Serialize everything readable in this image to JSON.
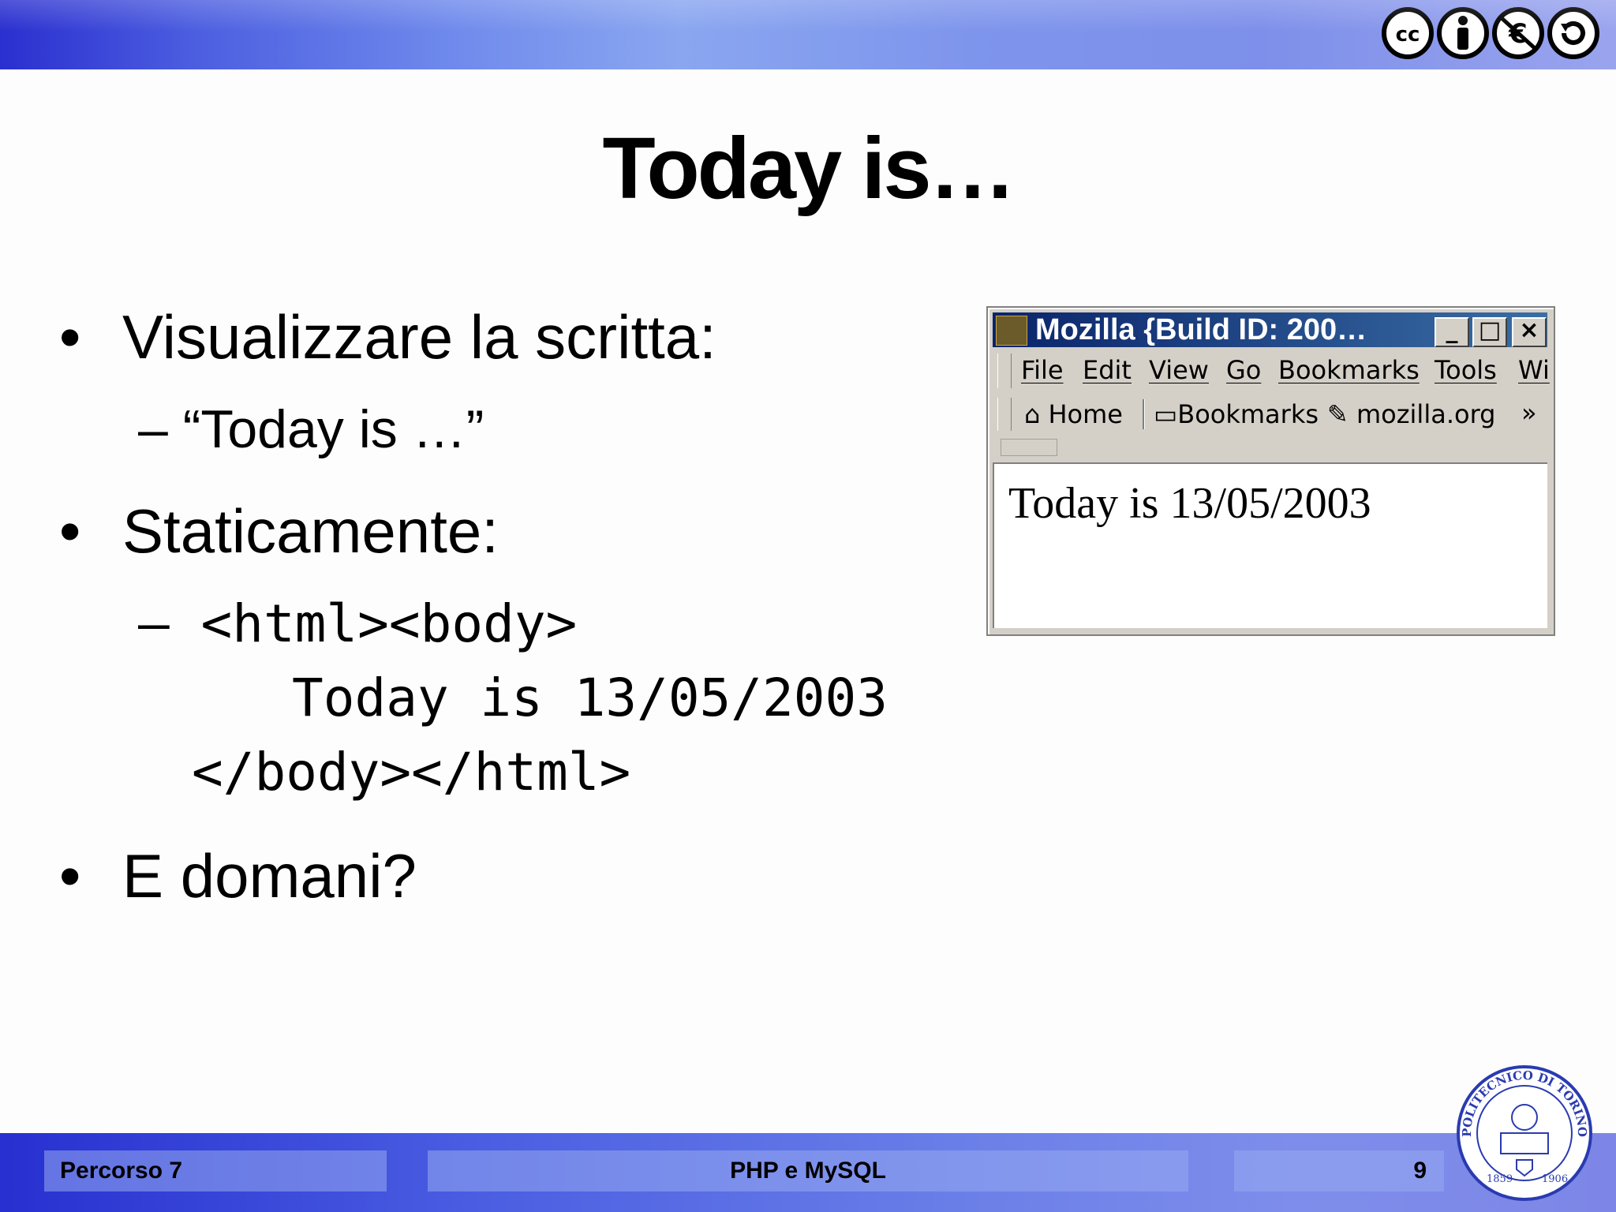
{
  "slide": {
    "title": "Today is…",
    "bullets": [
      {
        "text": "Visualizzare la scritta:",
        "sub": "– “Today is …”"
      },
      {
        "text": "Staticamente:",
        "code": [
          "– <html><body>",
          "Today is 13/05/2003",
          "</body></html>"
        ]
      },
      {
        "text": "E domani?"
      }
    ],
    "bullet_glyph": "•"
  },
  "browser": {
    "title": "Mozilla {Build ID: 200…",
    "controls": {
      "minimize": "_",
      "maximize": "□",
      "close": "×"
    },
    "menu": [
      "File",
      "Edit",
      "View",
      "Go",
      "Bookmarks",
      "Tools",
      "Wi"
    ],
    "toolbar": {
      "home": "Home",
      "bookmarks": "Bookmarks",
      "site": "mozilla.org",
      "more": "»"
    },
    "page_text": "Today is 13/05/2003"
  },
  "footer": {
    "left": "Percorso 7",
    "center": "PHP e MySQL",
    "page": "9"
  },
  "license_icons": [
    "cc-icon",
    "by-icon",
    "nc-icon",
    "sa-icon"
  ],
  "logo_text": {
    "top": "POLITECNICO DI TORINO",
    "year_left": "1859",
    "year_right": "1906"
  },
  "colors": {
    "bar_dark": "#2a2fcf",
    "bar_light": "#8aa6f0",
    "win_title": "#0a246a"
  }
}
